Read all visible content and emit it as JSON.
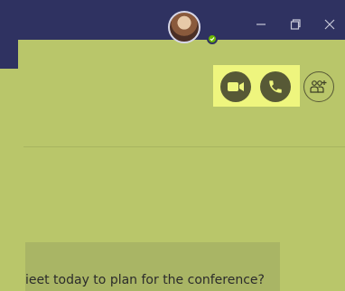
{
  "header": {
    "user": {
      "presence": "available"
    },
    "window_controls": [
      "minimize",
      "maximize",
      "close"
    ]
  },
  "call_actions": {
    "video_call": {
      "icon": "video-camera-icon"
    },
    "audio_call": {
      "icon": "phone-icon"
    },
    "add_people": {
      "icon": "add-people-icon"
    }
  },
  "message": {
    "text": "ieet today to plan for the conference?"
  },
  "colors": {
    "titlebar": "#2f3261",
    "background": "#b9c66a",
    "call_panel": "#eef57e",
    "button": "#575936",
    "presence": "#6bb700"
  }
}
